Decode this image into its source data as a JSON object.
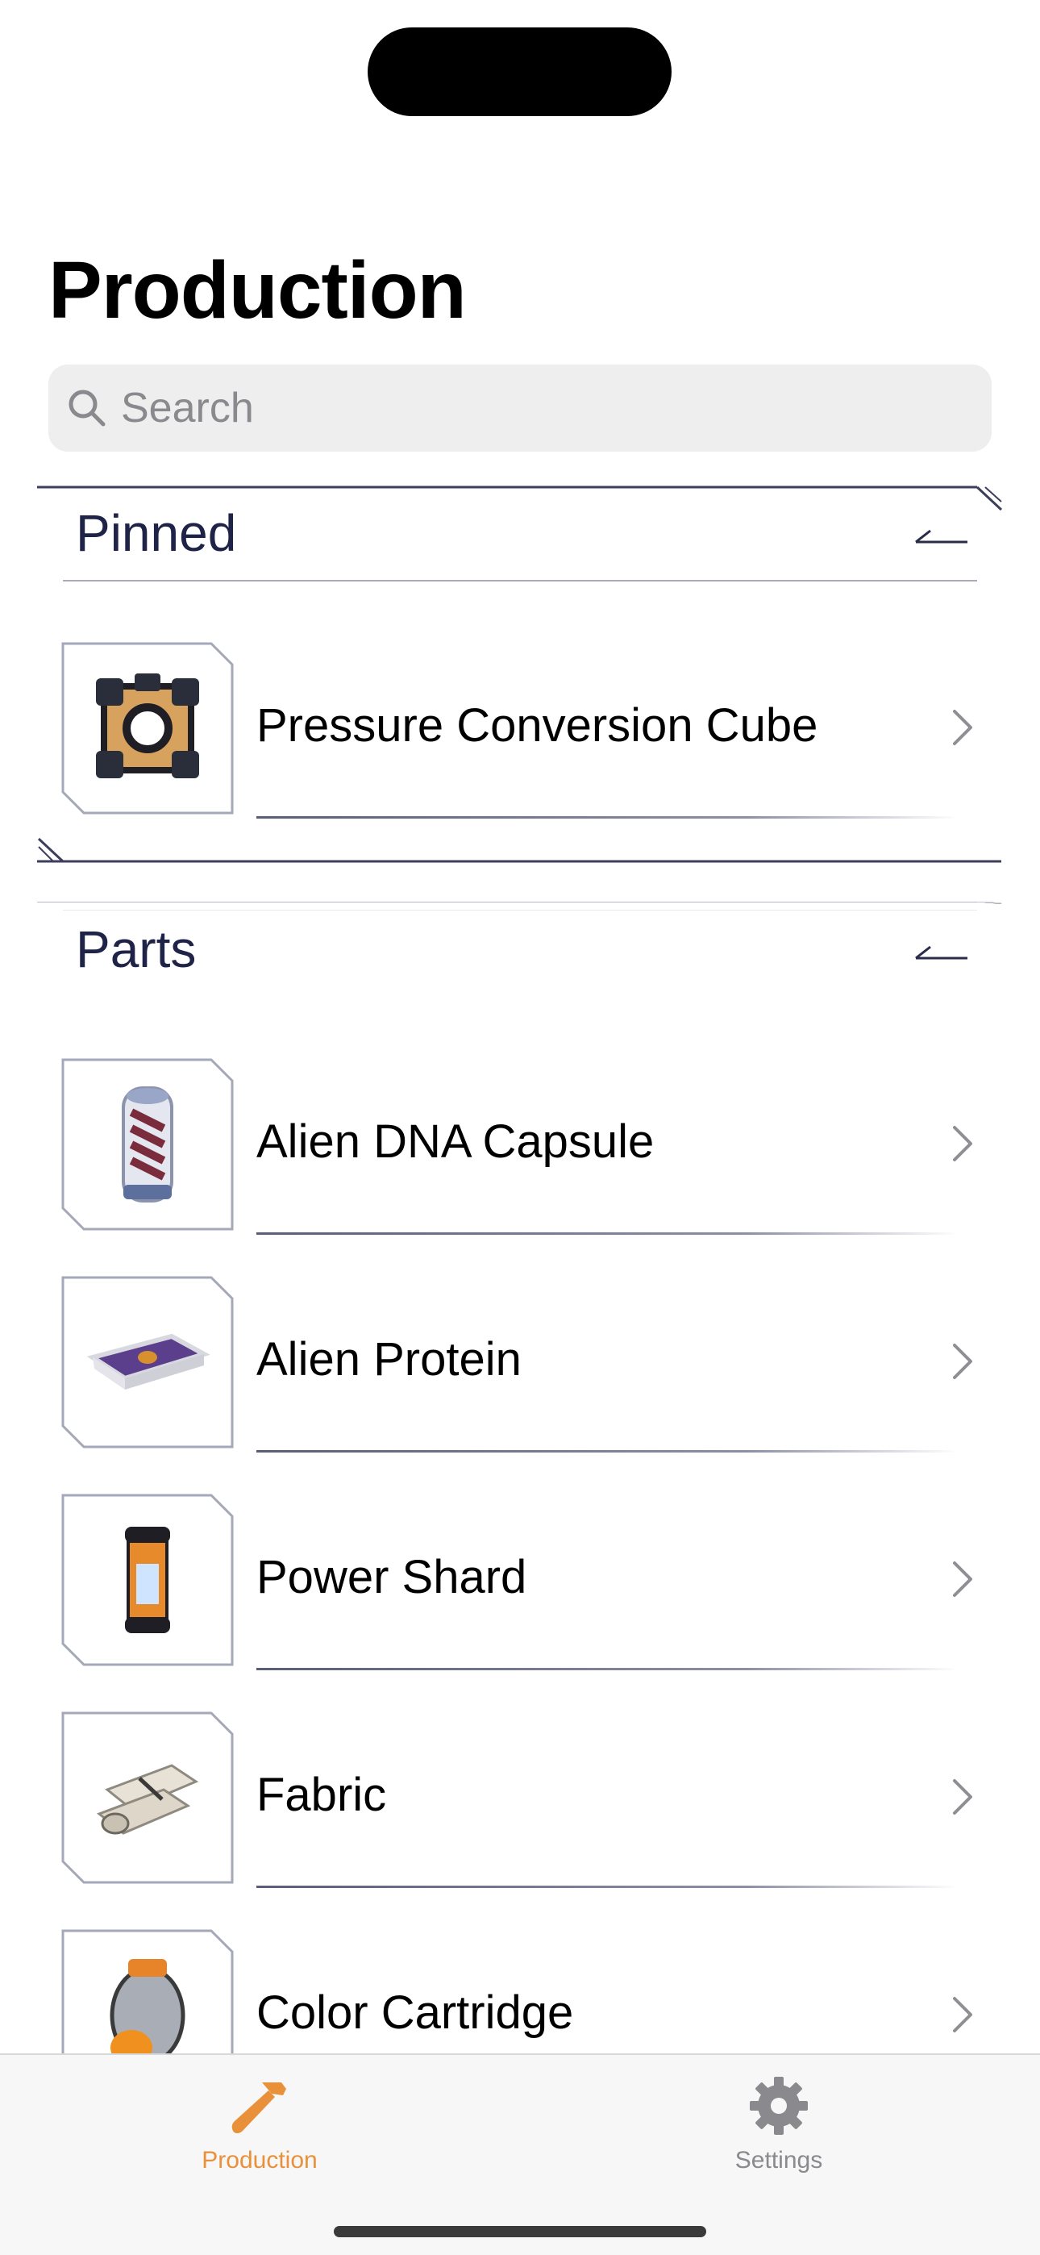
{
  "header": {
    "title": "Production"
  },
  "search": {
    "placeholder": "Search"
  },
  "sections": [
    {
      "title": "Pinned",
      "items": [
        {
          "label": "Pressure Conversion Cube",
          "icon": "pressure-cube-icon"
        }
      ]
    },
    {
      "title": "Parts",
      "items": [
        {
          "label": "Alien DNA Capsule",
          "icon": "dna-capsule-icon"
        },
        {
          "label": "Alien Protein",
          "icon": "alien-protein-icon"
        },
        {
          "label": "Power Shard",
          "icon": "power-shard-icon"
        },
        {
          "label": "Fabric",
          "icon": "fabric-icon"
        },
        {
          "label": "Color Cartridge",
          "icon": "color-cartridge-icon"
        }
      ]
    }
  ],
  "tabbar": {
    "tabs": [
      {
        "label": "Production",
        "icon": "hammer-icon",
        "selected": true
      },
      {
        "label": "Settings",
        "icon": "gear-icon",
        "selected": false
      }
    ]
  },
  "colors": {
    "accent": "#e9913a",
    "section_title": "#1f2347",
    "inactive": "#8a8a8e"
  }
}
